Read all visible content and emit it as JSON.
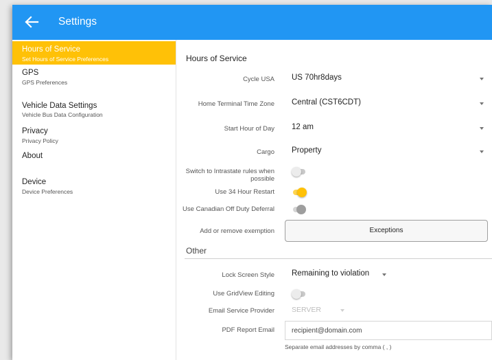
{
  "appbar": {
    "title": "Settings",
    "back_icon": "arrow-left-icon"
  },
  "sidebar": {
    "items": [
      {
        "label": "Hours of Service",
        "sub": "Set Hours of Service Preferences",
        "active": true
      },
      {
        "label": "GPS",
        "sub": "GPS Preferences"
      },
      {
        "label": "Vehicle Data Settings",
        "sub": "Vehicle Bus Data Configuration"
      },
      {
        "label": "Privacy",
        "sub": "Privacy Policy"
      },
      {
        "label": "About",
        "sub": ""
      },
      {
        "label": "Device",
        "sub": "Device Preferences"
      }
    ]
  },
  "hos": {
    "title": "Hours of Service",
    "cycle": {
      "label": "Cycle USA",
      "value": "US 70hr8days"
    },
    "timezone": {
      "label": "Home Terminal Time Zone",
      "value": "Central (CST6CDT)"
    },
    "start_hour": {
      "label": "Start Hour of Day",
      "value": "12 am"
    },
    "cargo": {
      "label": "Cargo",
      "value": "Property"
    },
    "intrastate": {
      "label": "Switch to Intrastate rules when possible",
      "on": false
    },
    "restart34": {
      "label": "Use 34 Hour Restart",
      "on": true
    },
    "canadian": {
      "label": "Use Canadian Off Duty Deferral",
      "on": true,
      "disabled": true
    },
    "exemption": {
      "label": "Add or remove exemption",
      "button": "Exceptions"
    }
  },
  "other": {
    "title": "Other",
    "lock_screen": {
      "label": "Lock Screen Style",
      "value": "Remaining to violation"
    },
    "gridview": {
      "label": "Use GridView Editing",
      "on": false
    },
    "email_provider": {
      "label": "Email Service Provider",
      "value": "SERVER"
    },
    "pdf_email": {
      "label": "PDF Report Email",
      "placeholder": "recipient@domain.com"
    },
    "helper": "Separate email addresses by comma ( , )"
  },
  "colors": {
    "appbar": "#2196f3",
    "accent": "#ffc107",
    "text": "#222222",
    "label": "#555555"
  }
}
